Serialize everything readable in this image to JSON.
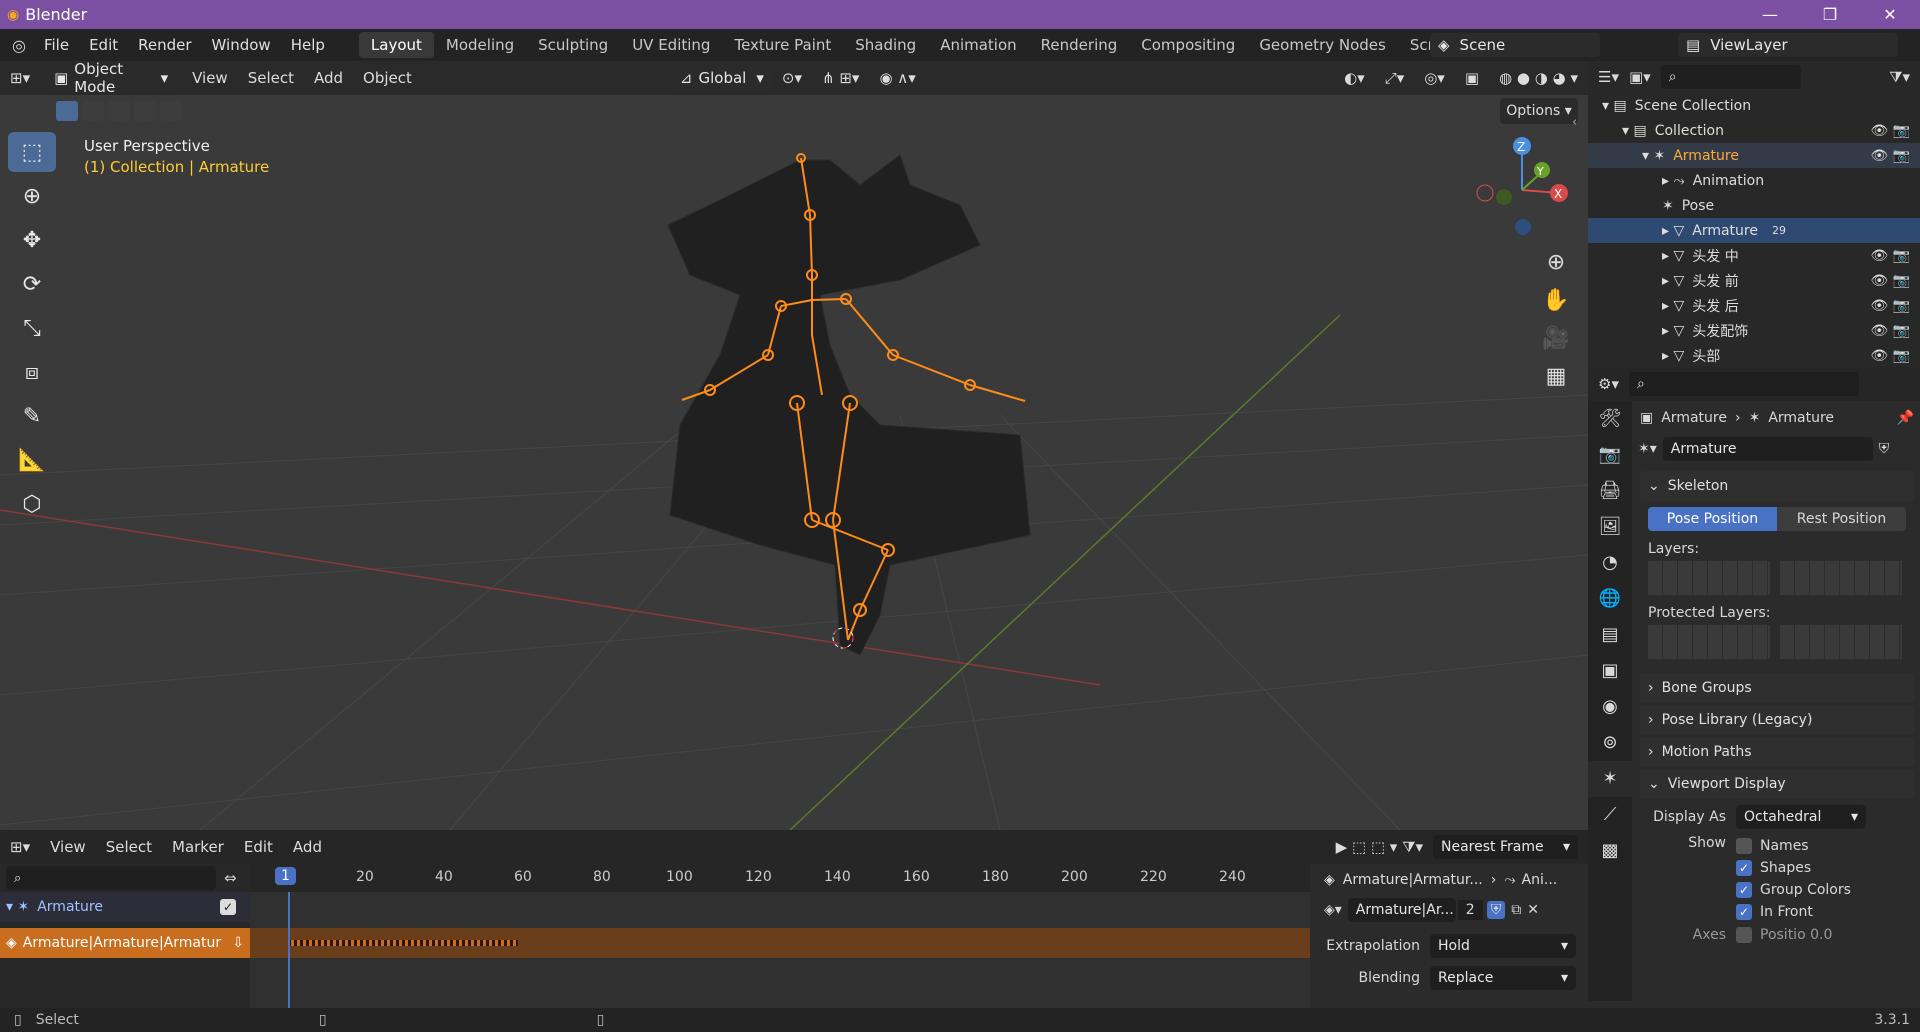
{
  "app": {
    "title": "Blender",
    "version": "3.3.1"
  },
  "menu": [
    "File",
    "Edit",
    "Render",
    "Window",
    "Help"
  ],
  "workspaces": [
    "Layout",
    "Modeling",
    "Sculpting",
    "UV Editing",
    "Texture Paint",
    "Shading",
    "Animation",
    "Rendering",
    "Compositing",
    "Geometry Nodes",
    "Scripting"
  ],
  "scene": "Scene",
  "viewlayer": "ViewLayer",
  "header3d": {
    "mode": "Object Mode",
    "menus": [
      "View",
      "Select",
      "Add",
      "Object"
    ],
    "orientation": "Global",
    "options": "Options"
  },
  "viewport": {
    "perspective": "User Perspective",
    "context": "(1) Collection | Armature",
    "axes": {
      "z": "Z",
      "y": "Y",
      "x": "X"
    }
  },
  "outliner": {
    "rows": [
      {
        "label": "Scene Collection",
        "indent": 0
      },
      {
        "label": "Collection",
        "indent": 1
      },
      {
        "label": "Armature",
        "indent": 2,
        "hl": true
      },
      {
        "label": "Animation",
        "indent": 3
      },
      {
        "label": "Pose",
        "indent": 3
      },
      {
        "label": "Armature",
        "indent": 3,
        "sel": true,
        "badge": "29"
      },
      {
        "label": "头发 中",
        "indent": 3
      },
      {
        "label": "头发 前",
        "indent": 3
      },
      {
        "label": "头发 后",
        "indent": 3
      },
      {
        "label": "头发配饰",
        "indent": 3
      },
      {
        "label": "头部",
        "indent": 3
      }
    ]
  },
  "props": {
    "crumb1": "Armature",
    "crumb2": "Armature",
    "datablock": "Armature",
    "skeleton": "Skeleton",
    "pose_position": "Pose Position",
    "rest_position": "Rest Position",
    "layers": "Layers:",
    "protected_layers": "Protected Layers:",
    "panels": [
      "Bone Groups",
      "Pose Library (Legacy)",
      "Motion Paths"
    ],
    "viewport_display": "Viewport Display",
    "display_as_label": "Display As",
    "display_as": "Octahedral",
    "show_label": "Show",
    "show": [
      {
        "label": "Names",
        "on": false
      },
      {
        "label": "Shapes",
        "on": true
      },
      {
        "label": "Group Colors",
        "on": true
      },
      {
        "label": "In Front",
        "on": true
      }
    ],
    "axes_label": "Axes",
    "axes_pos": "Positio 0.0"
  },
  "timeline": {
    "menus": [
      "View",
      "Select",
      "Marker",
      "Edit",
      "Add"
    ],
    "snap": "Nearest Frame",
    "current": "1",
    "ticks": [
      "20",
      "40",
      "60",
      "80",
      "100",
      "120",
      "140",
      "160",
      "180",
      "200",
      "220",
      "240"
    ],
    "track": "Armature",
    "action_track": "Armature|Armature|Armatur",
    "strip_crumb": "Armature|Armatur...",
    "strip_crumb2": "Ani...",
    "action": "Armature|Ar...",
    "users": "2",
    "extrapolation_label": "Extrapolation",
    "extrapolation": "Hold",
    "blending_label": "Blending",
    "blending": "Replace"
  },
  "status": {
    "left": "Select"
  }
}
